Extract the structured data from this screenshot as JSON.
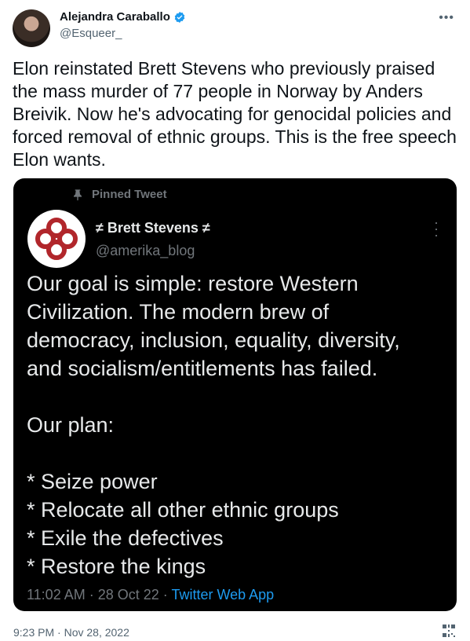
{
  "author": {
    "name": "Alejandra Caraballo",
    "handle": "@Esqueer_",
    "verified": true
  },
  "tweet": {
    "text": "Elon reinstated Brett Stevens who previously praised\nthe mass murder of 77 people in Norway by Anders\nBreivik. Now he's advocating for genocidal policies and\nforced removal of ethnic groups. This is the free speech\nElon wants.",
    "timestamp": "9:23 PM · Nov 28, 2022"
  },
  "embedded": {
    "pinned_label": "Pinned Tweet",
    "name": "≠ Brett Stevens ≠",
    "handle": "@amerika_blog",
    "text": "Our goal is simple: restore Western\nCivilization. The modern brew of\ndemocracy, inclusion, equality, diversity,\nand socialism/entitlements has failed.\n\nOur plan:\n\n* Seize power\n* Relocate all other ethnic groups\n* Exile the defectives\n* Restore the kings",
    "time": "11:02 AM",
    "date": "28 Oct 22",
    "app": "Twitter Web App",
    "logo_color": "#b1262b"
  },
  "colors": {
    "verified_blue": "#1d9bf0",
    "link_blue": "#1d9bf0",
    "embed_bg": "#000000"
  },
  "icons": {
    "more": "more-horizontal-icon",
    "pin": "pin-icon",
    "verified": "verified-badge-icon",
    "qr": "qr-code-icon"
  }
}
